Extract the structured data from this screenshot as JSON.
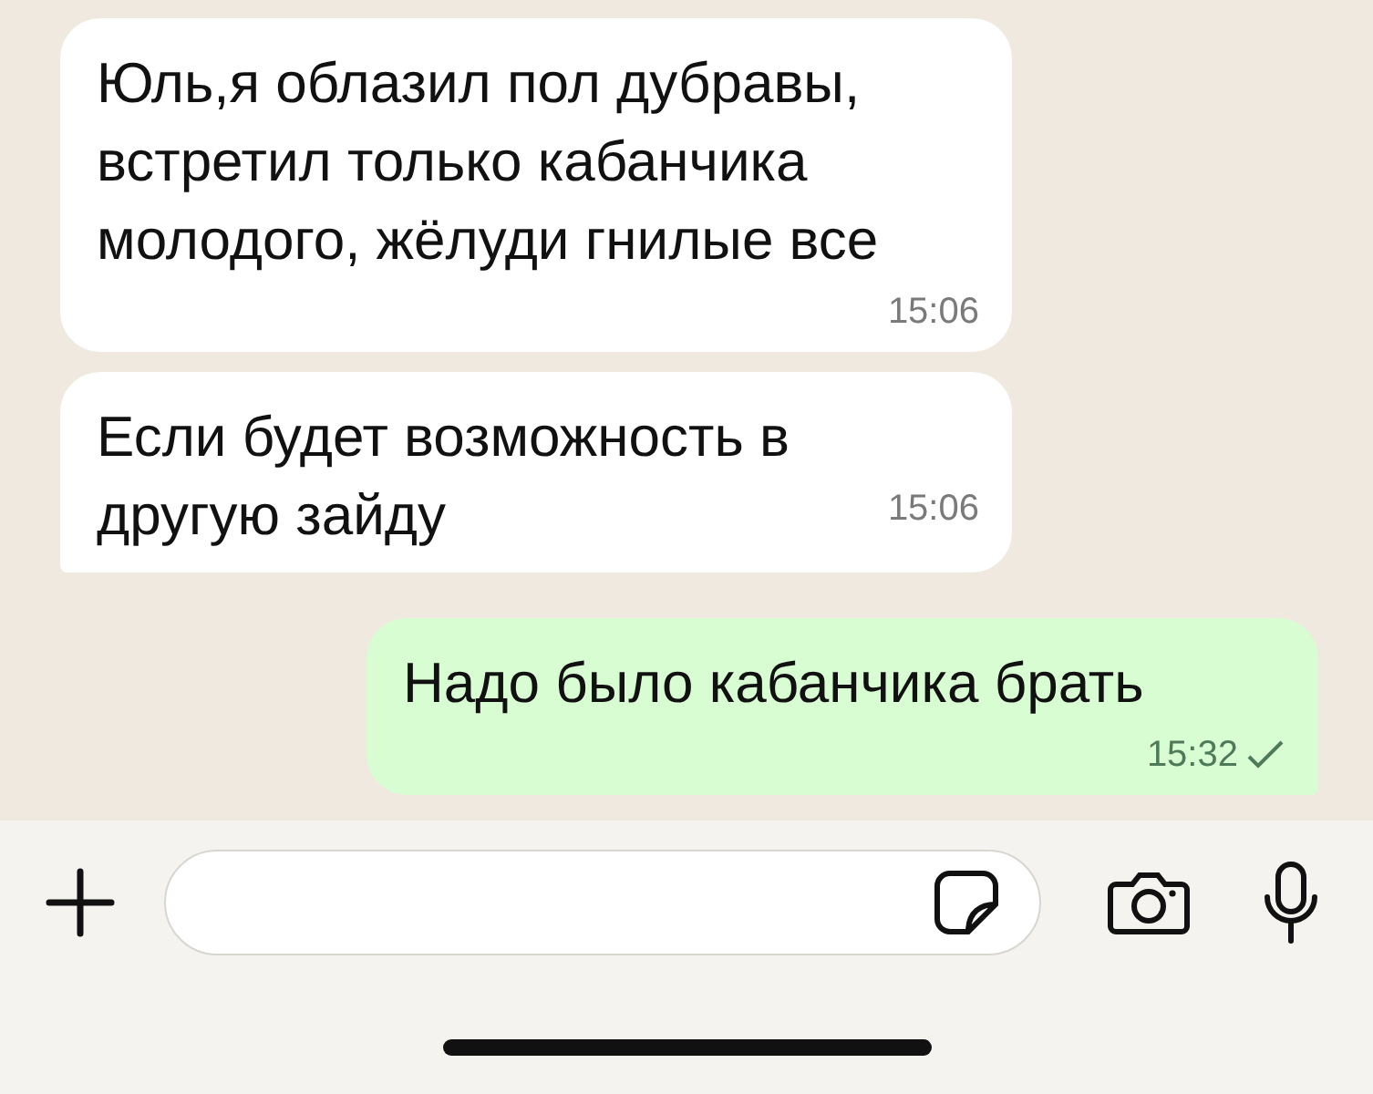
{
  "messages": [
    {
      "text": "Юль,я облазил пол дубравы, встретил только кабанчика молодого, жёлуди гнилые все",
      "time": "15:06",
      "outgoing": false,
      "tail": false
    },
    {
      "text": "Если будет возможность в другую зайду",
      "time": "15:06",
      "outgoing": false,
      "tail": true
    },
    {
      "text": "Надо было кабанчика брать",
      "time": "15:32",
      "outgoing": true,
      "tail": true,
      "delivered": false
    }
  ]
}
